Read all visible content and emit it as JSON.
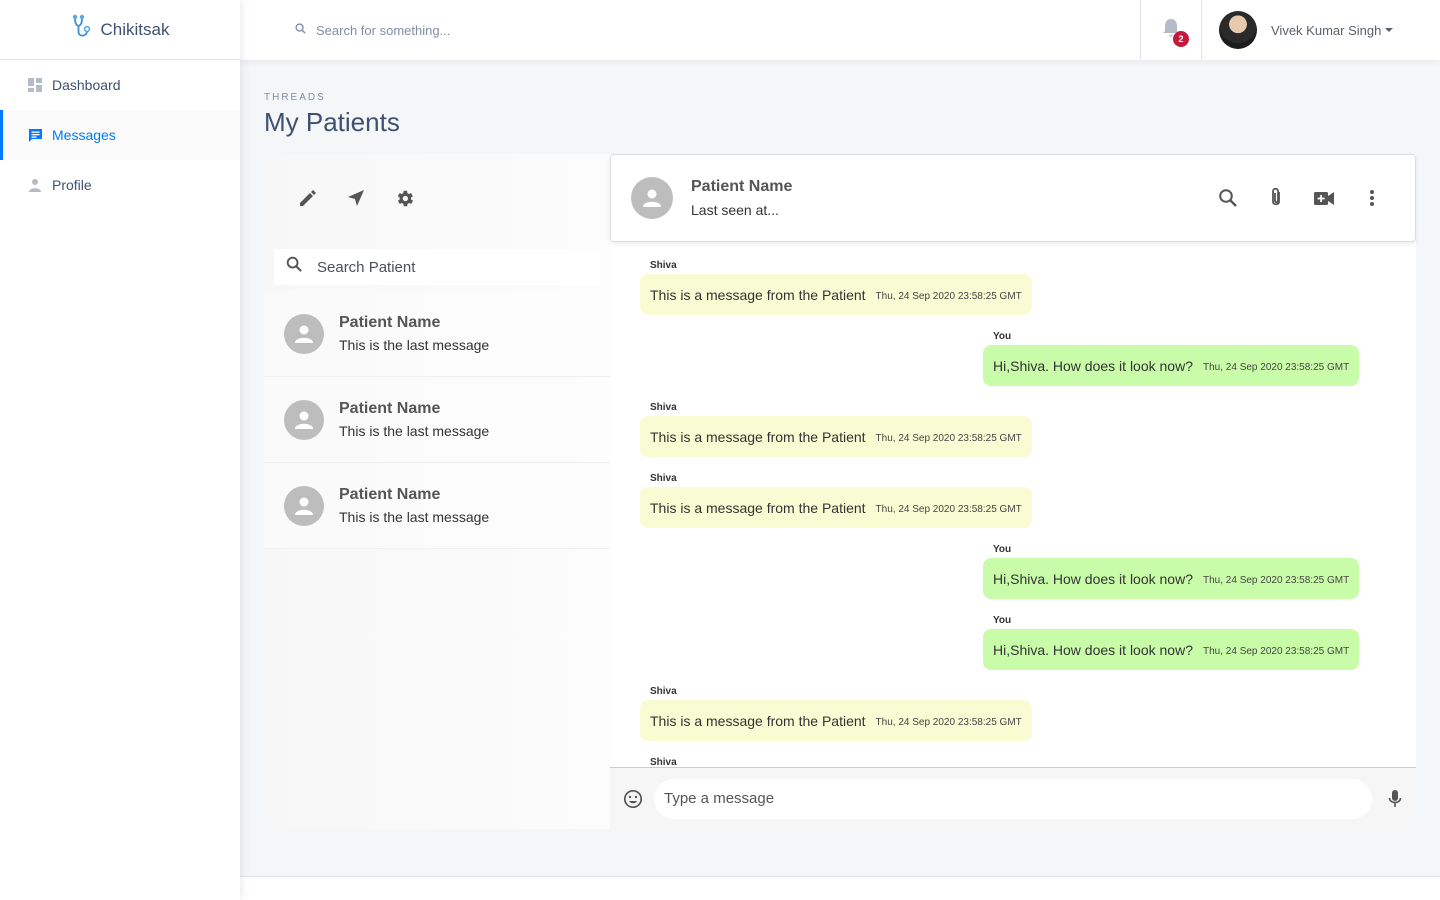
{
  "brand": {
    "name": "Chikitsak",
    "icon": "stethoscope-icon"
  },
  "sidebar": {
    "items": [
      {
        "label": "Dashboard",
        "icon": "dashboard-icon",
        "active": false
      },
      {
        "label": "Messages",
        "icon": "chat-icon",
        "active": true
      },
      {
        "label": "Profile",
        "icon": "person-icon",
        "active": false
      }
    ]
  },
  "topbar": {
    "search_placeholder": "Search for something...",
    "notification_count": "2",
    "user_name": "Vivek Kumar Singh"
  },
  "page": {
    "eyebrow": "THREADS",
    "title": "My Patients"
  },
  "threads": {
    "search_placeholder": "Search Patient",
    "items": [
      {
        "name": "Patient Name",
        "last": "This is the last message"
      },
      {
        "name": "Patient Name",
        "last": "This is the last message"
      },
      {
        "name": "Patient Name",
        "last": "This is the last message"
      }
    ]
  },
  "chat": {
    "name": "Patient Name",
    "status": "Last seen at...",
    "messages": [
      {
        "sender": "Shiva",
        "text": "This is a message from the Patient",
        "time": "Thu, 24 Sep 2020 23:58:25 GMT",
        "dir": "in"
      },
      {
        "sender": "You",
        "text": "Hi,Shiva. How does it look now?",
        "time": "Thu, 24 Sep 2020 23:58:25 GMT",
        "dir": "out"
      },
      {
        "sender": "Shiva",
        "text": "This is a message from the Patient",
        "time": "Thu, 24 Sep 2020 23:58:25 GMT",
        "dir": "in"
      },
      {
        "sender": "Shiva",
        "text": "This is a message from the Patient",
        "time": "Thu, 24 Sep 2020 23:58:25 GMT",
        "dir": "in"
      },
      {
        "sender": "You",
        "text": "Hi,Shiva. How does it look now?",
        "time": "Thu, 24 Sep 2020 23:58:25 GMT",
        "dir": "out"
      },
      {
        "sender": "You",
        "text": "Hi,Shiva. How does it look now?",
        "time": "Thu, 24 Sep 2020 23:58:25 GMT",
        "dir": "out"
      },
      {
        "sender": "Shiva",
        "text": "This is a message from the Patient",
        "time": "Thu, 24 Sep 2020 23:58:25 GMT",
        "dir": "in"
      },
      {
        "sender": "Shiva",
        "text": "",
        "time": "",
        "dir": "in"
      }
    ],
    "composer_placeholder": "Type a message"
  },
  "colors": {
    "accent": "#007bff",
    "incoming_bubble": "#f9fcd2",
    "outgoing_bubble": "#c9fca9",
    "badge": "#c4183c"
  }
}
